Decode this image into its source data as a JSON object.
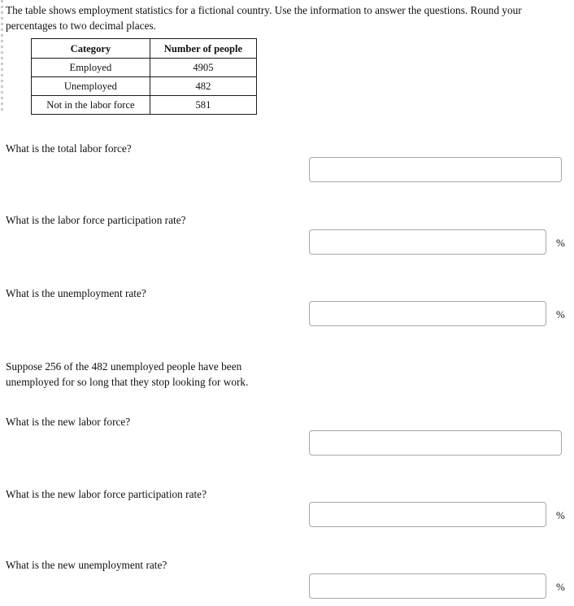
{
  "prompt": {
    "intro": "The table shows employment statistics for a fictional country. Use the information to answer the questions. Round your percentages to two decimal places.",
    "scenario_note": "Suppose 256 of the 482 unemployed people have been unemployed for so long that they stop looking for work."
  },
  "table": {
    "headers": [
      "Category",
      "Number of people"
    ],
    "rows": [
      {
        "category": "Employed",
        "count": "4905"
      },
      {
        "category": "Unemployed",
        "count": "482"
      },
      {
        "category": "Not in the labor force",
        "count": "581"
      }
    ]
  },
  "questions": [
    {
      "label": "What is the total labor force?",
      "value": "",
      "placeholder": "",
      "suffix": ""
    },
    {
      "label": "What is the labor force participation rate?",
      "value": "",
      "placeholder": "",
      "suffix": "%"
    },
    {
      "label": "What is the unemployment rate?",
      "value": "",
      "placeholder": "",
      "suffix": "%"
    },
    {
      "label": "What is the new labor force?",
      "value": "",
      "placeholder": "",
      "suffix": ""
    },
    {
      "label": "What is the new labor force participation rate?",
      "value": "",
      "placeholder": "",
      "suffix": "%"
    },
    {
      "label": "What is the new unemployment rate?",
      "value": "",
      "placeholder": "",
      "suffix": "%"
    }
  ],
  "colors": {
    "page_background": "#ffffff",
    "text": "#111111",
    "table_border": "#1b1b1b",
    "input_border": "#a6a6a6"
  }
}
